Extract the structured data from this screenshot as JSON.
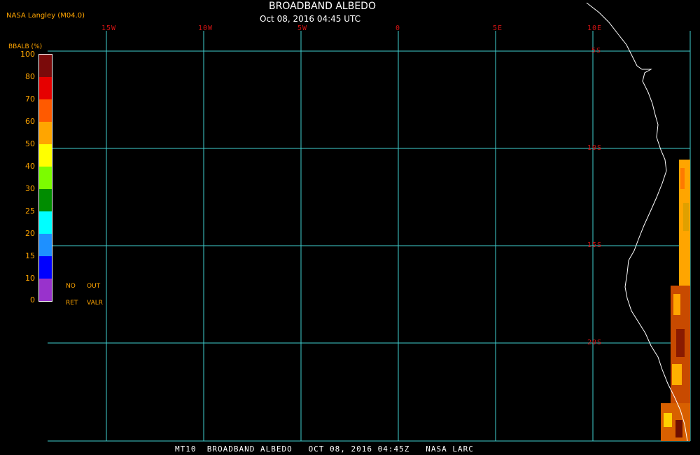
{
  "credit": "NASA Langley (M04.0)",
  "title": "BROADBAND ALBEDO",
  "subtitle": "Oct 08, 2016 04:45 UTC",
  "lon_labels": [
    "15W",
    "10W",
    "5W",
    "0",
    "5E",
    "10E"
  ],
  "lat_labels": [
    "5S",
    "10S",
    "15S",
    "20S"
  ],
  "legend": {
    "title": "BBALB (%)",
    "ticks": [
      "100",
      "80",
      "70",
      "60",
      "50",
      "40",
      "30",
      "25",
      "20",
      "15",
      "10",
      "0"
    ],
    "colors": [
      "#7a0a0a",
      "#e60000",
      "#ff5a00",
      "#ffa500",
      "#ffff00",
      "#7cfc00",
      "#008c00",
      "#00ffff",
      "#1e90ff",
      "#0000ff",
      "#9932cc"
    ],
    "no_ret": [
      "NO",
      "RET"
    ],
    "out_valr": [
      "OUT",
      "VALR"
    ]
  },
  "footer": "MT10  BROADBAND ALBEDO   OCT 08, 2016 04:45Z   NASA LARC",
  "grid_color": "#40d0d0",
  "label_color": "#d21414",
  "coast_color": "#ffffff"
}
